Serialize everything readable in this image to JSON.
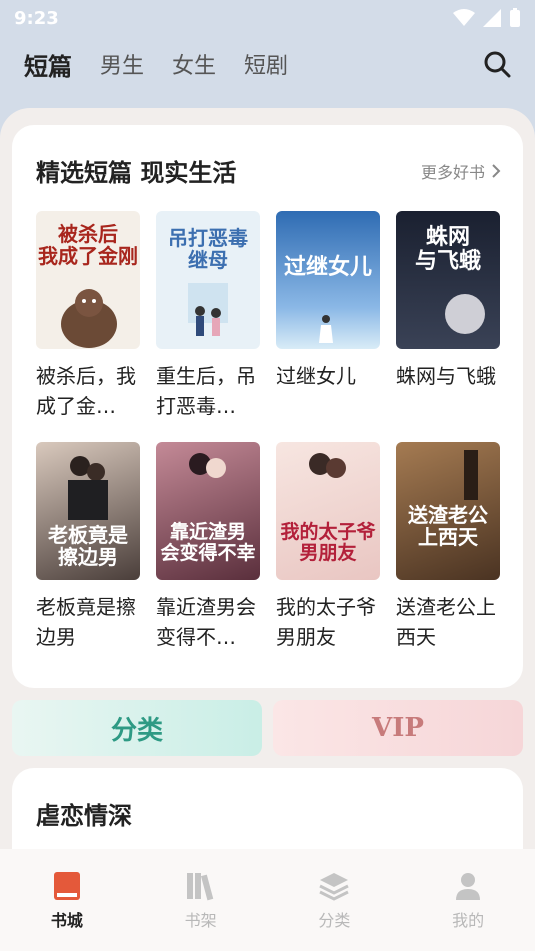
{
  "status": {
    "time": "9:23"
  },
  "tabs": [
    {
      "label": "短篇",
      "active": true
    },
    {
      "label": "男生"
    },
    {
      "label": "女生"
    },
    {
      "label": "短剧"
    }
  ],
  "featured": {
    "title": "精选短篇 现实生活",
    "more": "更多好书",
    "books": [
      {
        "title": "被杀后，我成了金…",
        "cover_text": "被杀后\n我成了金刚",
        "cover_bg": "#f4efe8"
      },
      {
        "title": "重生后，吊打恶毒…",
        "cover_text": "吊打恶毒\n继母",
        "cover_bg": "#e8f1f7"
      },
      {
        "title": "过继女儿",
        "cover_text": "过继女儿",
        "cover_bg": "#3c7fc6"
      },
      {
        "title": "蛛网与飞蛾",
        "cover_text": "蛛网\n与飞蛾",
        "cover_bg": "#1f2533"
      },
      {
        "title": "老板竟是擦边男",
        "cover_text": "老板竟是\n擦边男",
        "cover_bg": "#5a4f4b"
      },
      {
        "title": "靠近渣男会变得不…",
        "cover_text": "靠近渣男\n会变得不幸",
        "cover_bg": "#7a4a58"
      },
      {
        "title": "我的太子爷男朋友",
        "cover_text": "我的太子爷\n男朋友",
        "cover_bg": "#f3dcd8"
      },
      {
        "title": "送渣老公上西天",
        "cover_text": "送渣老公\n上西天",
        "cover_bg": "#7d5a3a"
      }
    ]
  },
  "pills": {
    "category": "分类",
    "vip": "VIP"
  },
  "second_section": {
    "title": "虐恋情深"
  },
  "bottom_nav": [
    {
      "label": "书城",
      "icon": "book-icon",
      "active": true
    },
    {
      "label": "书架",
      "icon": "shelf-icon"
    },
    {
      "label": "分类",
      "icon": "layers-icon"
    },
    {
      "label": "我的",
      "icon": "person-icon"
    }
  ]
}
